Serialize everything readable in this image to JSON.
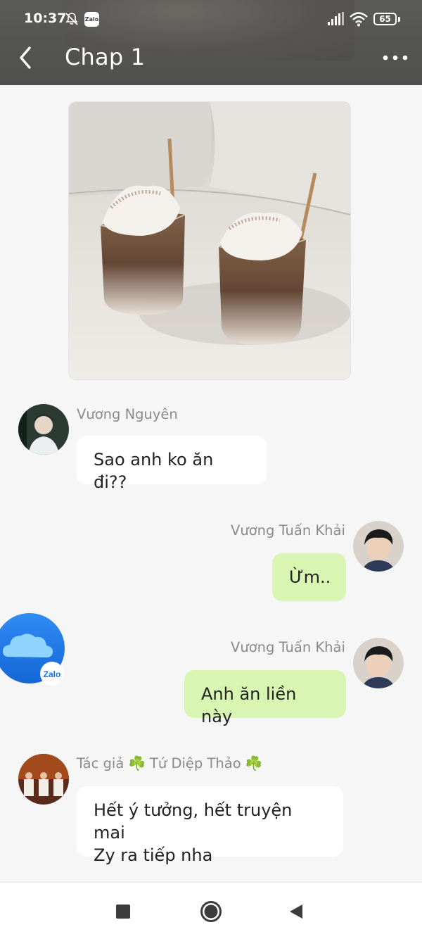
{
  "status_bar": {
    "time": "10:37",
    "battery": "65",
    "notification_icons": [
      "mute-bell-icon",
      "zalo-app-icon"
    ],
    "zalo_badge_text": "Zalo"
  },
  "header": {
    "title": "Chap 1",
    "back_icon": "chevron-left-icon",
    "more_icon": "ellipsis-icon"
  },
  "messages": [
    {
      "sender": "Vương Nguyên",
      "text": "Sao anh ko ăn đi??",
      "side": "left"
    },
    {
      "sender": "Vương Tuấn Khải",
      "text": "Ừm..",
      "side": "right"
    },
    {
      "sender": "Vương Tuấn Khải",
      "text": "Anh ăn liền này",
      "side": "right"
    },
    {
      "sender_prefix": "Tác giả",
      "sender_name": "Tứ Diệp Thảo",
      "clover": "☘️",
      "text_line1": "Hết ý tưởng, hết truyện mai",
      "text_line2": "Zy ra tiếp nha",
      "side": "left"
    }
  ],
  "floating_bubble": {
    "label": "Zalo"
  },
  "colors": {
    "header_bg": "#4f4f4d",
    "chat_bg": "#f6f6f6",
    "incoming_bubble": "#ffffff",
    "outgoing_bubble": "#d9f5b2",
    "zalo_blue": "#1a73e8"
  },
  "nav": [
    "recent-apps-square-icon",
    "home-circle-icon",
    "back-triangle-icon"
  ]
}
